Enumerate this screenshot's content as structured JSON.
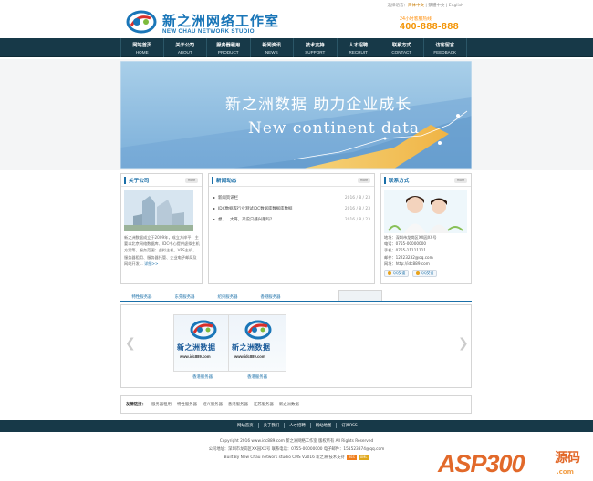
{
  "header": {
    "logo_cn": "新之洲网络工作室",
    "logo_en": "NEW CHAU NETWORK STUDIO",
    "lang_prefix": "选择语言：",
    "lang_current": "简体中文",
    "lang_others": " | 繁體中文 | English",
    "hotline_label": "24小时客服热线",
    "hotline_number": "400-888-888"
  },
  "nav": {
    "items": [
      {
        "cn": "网站首页",
        "en": "HOME"
      },
      {
        "cn": "关于公司",
        "en": "ABOUT"
      },
      {
        "cn": "服务器租用",
        "en": "PRODUCT"
      },
      {
        "cn": "新闻资讯",
        "en": "NEWS"
      },
      {
        "cn": "技术支持",
        "en": "SUPPORT"
      },
      {
        "cn": "人才招聘",
        "en": "RECRUIT"
      },
      {
        "cn": "联系方式",
        "en": "CONTACT"
      },
      {
        "cn": "访客留言",
        "en": "FEEDBACK"
      }
    ]
  },
  "banner": {
    "headline_cn": "新之洲数据  助力企业成长",
    "headline_en": "New continent data"
  },
  "about": {
    "title": "关于公司",
    "more": "more",
    "text": "新之洲数据成立于2009年，成立方岸平，主要以北京网络数据库、IDC中心提供虚拟主机方案等，服务范围：虚拟主机、VPS主机、服务器租用、服务器托管、企业电子邮局及网站开发...",
    "read_more": "详细>>"
  },
  "news": {
    "title": "新闻动态",
    "more": "more",
    "items": [
      {
        "title": "新闻资讯栏",
        "date": "2016 / 8 / 23"
      },
      {
        "title": "IDC数据库行业测试IDC数据库数据库数据",
        "date": "2016 / 8 / 23"
      },
      {
        "title": "想、...大哥，来说只感兴趣吗？",
        "date": "2016 / 8 / 23"
      }
    ]
  },
  "contact": {
    "title": "联系方式",
    "more": "more",
    "lines": [
      "地址：深圳市龙岗区XX园XX号",
      "电话：0755-00000000",
      "手机：0755-11111111",
      "邮件：12223232@qq.com",
      "网址：http://idc889.com"
    ],
    "qq_buttons": [
      "QQ交谈",
      "QQ交谈"
    ]
  },
  "tabs": {
    "items": [
      "特性服务器",
      "东莞服务器",
      "绍兴服务器",
      "香港服务器"
    ]
  },
  "partners": {
    "items": [
      {
        "logo_text": "新之洲数据",
        "url": "www.idc889.com",
        "name": "香港服务器"
      },
      {
        "logo_text": "新之洲数据",
        "url": "www.idc889.com",
        "name": "香港服务器"
      }
    ]
  },
  "friend_links": {
    "label": "友情链接：",
    "items": [
      "服务器租用",
      "特性服务器",
      "绍兴服务器",
      "香港服务器",
      "江苏服务器",
      "新之洲数据"
    ]
  },
  "footer": {
    "nav": [
      "网站首页",
      "关于我们",
      "人才招聘",
      "网站地图",
      "订阅RSS"
    ],
    "copyright": "Copyright 2016 www.idc889.com 新之洲网络工作室 版权所有 All Rights Reserved",
    "address_line": "公司地址：深圳市龙岗区XX园XX号 联系电话：0755-00000000 电子邮件：151523874@qq.com",
    "built_line": "Built By New Chau network studio CMS V2016 新之洲 技术支持",
    "badge_rss": "RSS",
    "badge_xml": "XML"
  },
  "watermark": {
    "text": "ASP300",
    "cn": "源码",
    "sub": ".com"
  }
}
